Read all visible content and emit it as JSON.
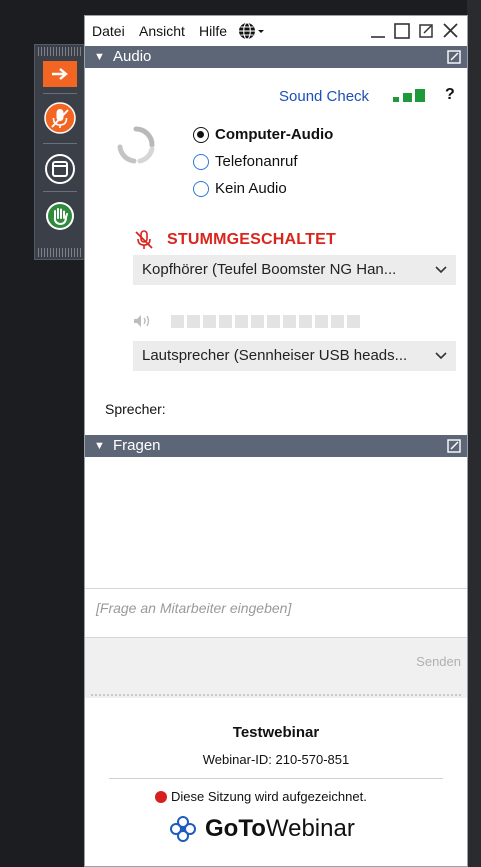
{
  "menu": {
    "datei": "Datei",
    "ansicht": "Ansicht",
    "hilfe": "Hilfe"
  },
  "audio": {
    "section_title": "Audio",
    "sound_check": "Sound Check",
    "help": "?",
    "options": [
      "Computer-Audio",
      "Telefonanruf",
      "Kein Audio"
    ],
    "selected_option": "Computer-Audio",
    "muted_label": "STUMMGESCHALTET",
    "microphone_select": "Kopfhörer (Teufel Boomster NG Han...",
    "speaker_select": "Lautsprecher (Sennheiser USB heads...",
    "speaker_level": 0,
    "sprecher_label": "Sprecher:"
  },
  "questions": {
    "section_title": "Fragen",
    "input_placeholder": "[Frage an Mitarbeiter eingeben]",
    "send_label": "Senden"
  },
  "footer": {
    "webinar_title": "Testwebinar",
    "webinar_id": "Webinar-ID: 210-570-851",
    "recording_notice": "Diese Sitzung wird aufgezeichnet.",
    "logo_goto": "GoTo",
    "logo_webinar": "Webinar"
  },
  "colors": {
    "accent_orange": "#f26522",
    "header_bar": "#5d6677",
    "muted_red": "#d9251d",
    "link_blue": "#1b4fb8",
    "signal_green": "#1e9a3a"
  }
}
